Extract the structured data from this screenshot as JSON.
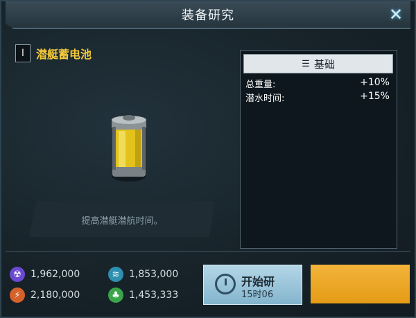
{
  "window": {
    "title": "装备研究",
    "close_icon": "close-icon"
  },
  "item": {
    "level": "I",
    "name": "潜艇蓄电池",
    "description": "提高潜艇潜航时间。",
    "image_icon": "battery-icon"
  },
  "stats": {
    "header": "基础",
    "rows": [
      {
        "label": "总重量:",
        "value": "+10%"
      },
      {
        "label": "潜水时间:",
        "value": "+15%"
      }
    ]
  },
  "resources": [
    {
      "icon": "radiation-icon",
      "amount": "1,962,000",
      "color": "#6a4ad0"
    },
    {
      "icon": "layers-icon",
      "amount": "1,853,000",
      "color": "#2f8fb0"
    },
    {
      "icon": "lightning-icon",
      "amount": "2,180,000",
      "color": "#d4622a"
    },
    {
      "icon": "plant-icon",
      "amount": "1,453,333",
      "color": "#3aa64a"
    }
  ],
  "actions": {
    "research_label": "开始研",
    "research_time": "15时06"
  },
  "colors": {
    "accent_gold": "#f3c93a",
    "button_blue": "#a8cfe2",
    "button_gold": "#eba62a"
  }
}
